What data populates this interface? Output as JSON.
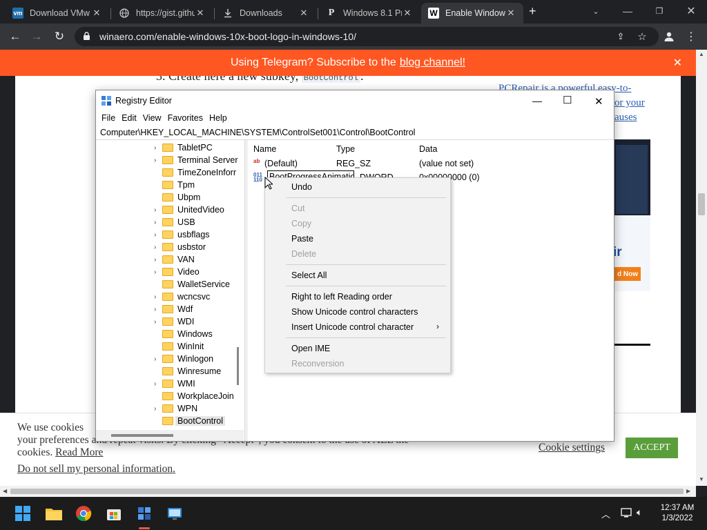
{
  "browser": {
    "tabs": [
      {
        "title": "Download VMw",
        "favicon": "vmware-icon"
      },
      {
        "title": "https://gist.githu",
        "favicon": "globe-icon"
      },
      {
        "title": "Downloads",
        "favicon": "download-icon"
      },
      {
        "title": "Windows 8.1 Pro",
        "favicon": "pinterest-icon"
      },
      {
        "title": "Enable Window",
        "favicon": "winaero-icon"
      }
    ],
    "url": "winaero.com/enable-windows-10x-boot-logo-in-windows-10/"
  },
  "page": {
    "banner_text": "Using Telegram? Subscribe to the",
    "banner_link": "blog channel!",
    "step_text": "3. Create here a new subkey,",
    "step_code": "BootControl",
    "side_ad_lines": [
      "PCRepair is a powerful easy-to-",
      "or your",
      "auses"
    ],
    "ad_pair": "ir",
    "ad_button": "d Now",
    "cookie_text_1": "We use cookies",
    "cookie_text_2": "your preferences and repeat visits. By clicking “Accept”, you consent to the use of ALL the",
    "cookie_text_3": "cookies.",
    "read_more": "Read More",
    "do_not_sell": "Do not sell my personal information",
    "cookie_settings": "Cookie settings",
    "accept": "ACCEPT"
  },
  "regedit": {
    "title": "Registry Editor",
    "menu": [
      "File",
      "Edit",
      "View",
      "Favorites",
      "Help"
    ],
    "address": "Computer\\HKEY_LOCAL_MACHINE\\SYSTEM\\ControlSet001\\Control\\BootControl",
    "tree": [
      {
        "label": "TabletPC",
        "expand": true
      },
      {
        "label": "Terminal Server",
        "expand": true
      },
      {
        "label": "TimeZoneInforr",
        "expand": false
      },
      {
        "label": "Tpm",
        "expand": false
      },
      {
        "label": "Ubpm",
        "expand": false
      },
      {
        "label": "UnitedVideo",
        "expand": true
      },
      {
        "label": "USB",
        "expand": true
      },
      {
        "label": "usbflags",
        "expand": true
      },
      {
        "label": "usbstor",
        "expand": true
      },
      {
        "label": "VAN",
        "expand": true
      },
      {
        "label": "Video",
        "expand": true
      },
      {
        "label": "WalletService",
        "expand": false
      },
      {
        "label": "wcncsvc",
        "expand": true
      },
      {
        "label": "Wdf",
        "expand": true
      },
      {
        "label": "WDI",
        "expand": true
      },
      {
        "label": "Windows",
        "expand": false
      },
      {
        "label": "WinInit",
        "expand": false
      },
      {
        "label": "Winlogon",
        "expand": true
      },
      {
        "label": "Winresume",
        "expand": false
      },
      {
        "label": "WMI",
        "expand": true
      },
      {
        "label": "WorkplaceJoin",
        "expand": false
      },
      {
        "label": "WPN",
        "expand": true
      },
      {
        "label": "BootControl",
        "expand": false,
        "selected": true
      }
    ],
    "columns": {
      "name": "Name",
      "type": "Type",
      "data": "Data"
    },
    "values": [
      {
        "name": "(Default)",
        "type": "REG_SZ",
        "data": "(value not set)"
      },
      {
        "name": "BootProgressAnimation",
        "type": "REG_DWORD",
        "data": "0x00000000 (0)"
      }
    ]
  },
  "context_menu": {
    "items": [
      {
        "label": "Undo",
        "enabled": true
      },
      {
        "label": "Cut",
        "enabled": false
      },
      {
        "label": "Copy",
        "enabled": false
      },
      {
        "label": "Paste",
        "enabled": true
      },
      {
        "label": "Delete",
        "enabled": false
      },
      {
        "label": "Select All",
        "enabled": true
      },
      {
        "label": "Right to left Reading order",
        "enabled": true
      },
      {
        "label": "Show Unicode control characters",
        "enabled": true
      },
      {
        "label": "Insert Unicode control character",
        "enabled": true
      },
      {
        "label": "Open IME",
        "enabled": true
      },
      {
        "label": "Reconversion",
        "enabled": false
      }
    ]
  },
  "taskbar": {
    "time": "12:37 AM",
    "date": "1/3/2022"
  },
  "colors": {
    "banner": "#ff5722",
    "accept": "#5a9e3b",
    "link": "#2a5db0"
  }
}
